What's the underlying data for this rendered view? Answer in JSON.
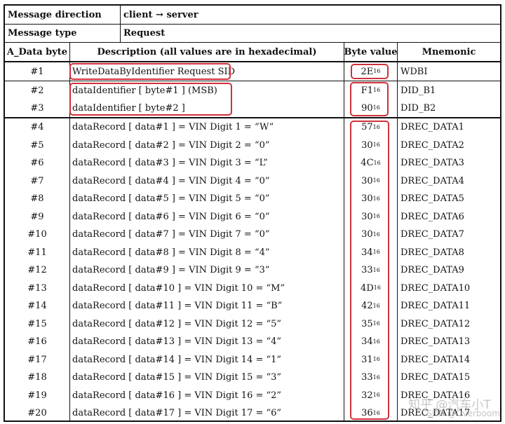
{
  "header": {
    "direction_label": "Message direction",
    "direction_value": "client → server",
    "type_label": "Message type",
    "type_value": "Request"
  },
  "columns": [
    "A_Data byte",
    "Description (all values are in hexadecimal)",
    "Byte value",
    "Mnemonic"
  ],
  "hex_subscript": "16",
  "rows": [
    {
      "byte": "#1",
      "desc": "WriteDataByIdentifier Request SID",
      "value": "2E",
      "mnemonic": "WDBI"
    },
    {
      "byte": "#2",
      "desc": "dataIdentifier [ byte#1 ] (MSB)",
      "value": "F1",
      "mnemonic": "DID_B1"
    },
    {
      "byte": "#3",
      "desc": "dataIdentifier [ byte#2 ]",
      "value": "90",
      "mnemonic": "DID_B2"
    },
    {
      "byte": "#4",
      "desc": "dataRecord [ data#1 ] = VIN Digit 1 = “W”",
      "value": "57",
      "mnemonic": "DREC_DATA1"
    },
    {
      "byte": "#5",
      "desc": "dataRecord [ data#2 ] = VIN Digit 2 = “0”",
      "value": "30",
      "mnemonic": "DREC_DATA2"
    },
    {
      "byte": "#6",
      "desc": "dataRecord [ data#3 ] = VIN Digit 3 = “L”",
      "value": "4C",
      "mnemonic": "DREC_DATA3"
    },
    {
      "byte": "#7",
      "desc": "dataRecord [ data#4 ] = VIN Digit 4 = “0”",
      "value": "30",
      "mnemonic": "DREC_DATA4"
    },
    {
      "byte": "#8",
      "desc": "dataRecord [ data#5 ] = VIN Digit 5 = “0”",
      "value": "30",
      "mnemonic": "DREC_DATA5"
    },
    {
      "byte": "#9",
      "desc": "dataRecord [ data#6 ] = VIN Digit 6 = “0”",
      "value": "30",
      "mnemonic": "DREC_DATA6"
    },
    {
      "byte": "#10",
      "desc": "dataRecord [ data#7 ] = VIN Digit 7 = “0”",
      "value": "30",
      "mnemonic": "DREC_DATA7"
    },
    {
      "byte": "#11",
      "desc": "dataRecord [ data#8 ] = VIN Digit 8 = “4”",
      "value": "34",
      "mnemonic": "DREC_DATA8"
    },
    {
      "byte": "#12",
      "desc": "dataRecord [ data#9 ] = VIN Digit 9 = “3”",
      "value": "33",
      "mnemonic": "DREC_DATA9"
    },
    {
      "byte": "#13",
      "desc": "dataRecord [ data#10 ] = VIN Digit 10 = “M”",
      "value": "4D",
      "mnemonic": "DREC_DATA10"
    },
    {
      "byte": "#14",
      "desc": "dataRecord [ data#11 ] = VIN Digit 11 = “B”",
      "value": "42",
      "mnemonic": "DREC_DATA11"
    },
    {
      "byte": "#15",
      "desc": "dataRecord [ data#12 ] = VIN Digit 12 = “5”",
      "value": "35",
      "mnemonic": "DREC_DATA12"
    },
    {
      "byte": "#16",
      "desc": "dataRecord [ data#13 ] = VIN Digit 13 = “4”",
      "value": "34",
      "mnemonic": "DREC_DATA13"
    },
    {
      "byte": "#17",
      "desc": "dataRecord [ data#14 ] = VIN Digit 14 = “1”",
      "value": "31",
      "mnemonic": "DREC_DATA14"
    },
    {
      "byte": "#18",
      "desc": "dataRecord [ data#15 ] = VIN Digit 15 = “3”",
      "value": "33",
      "mnemonic": "DREC_DATA15"
    },
    {
      "byte": "#19",
      "desc": "dataRecord [ data#16 ] = VIN Digit 16 = “2”",
      "value": "32",
      "mnemonic": "DREC_DATA16"
    },
    {
      "byte": "#20",
      "desc": "dataRecord [ data#17 ] = VIN Digit 17 = “6”",
      "value": "36",
      "mnemonic": "DREC_DATA17"
    }
  ],
  "watermark": {
    "line1": "知乎 @汽车小T",
    "line2": "CSDN @Overboom"
  },
  "colors": {
    "highlight": "#d0303a"
  }
}
